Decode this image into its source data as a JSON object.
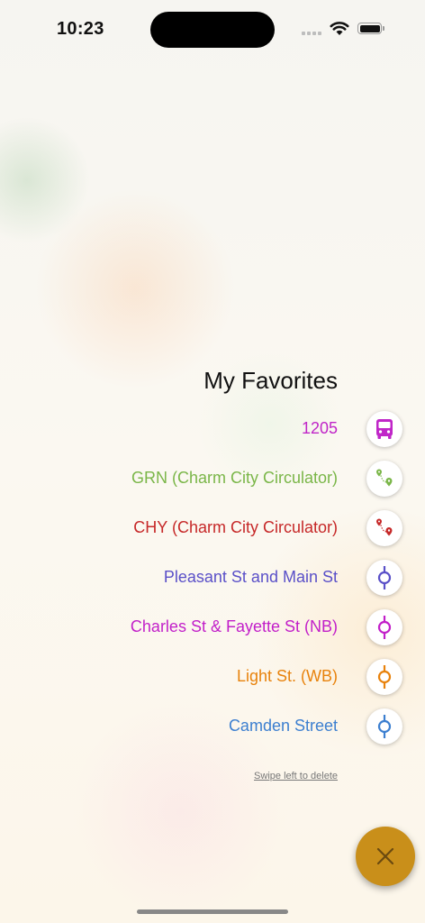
{
  "status_bar": {
    "time": "10:23"
  },
  "favorites": {
    "title": "My Favorites",
    "items": [
      {
        "label": "1205",
        "color": "#c026c8",
        "icon": "bus-icon"
      },
      {
        "label": "GRN (Charm City Circulator)",
        "color": "#7ab648",
        "icon": "route-icon"
      },
      {
        "label": "CHY (Charm City Circulator)",
        "color": "#c62828",
        "icon": "route-icon"
      },
      {
        "label": "Pleasant St and Main St",
        "color": "#5a50c8",
        "icon": "stop-icon"
      },
      {
        "label": "Charles St & Fayette St (NB)",
        "color": "#c21fc9",
        "icon": "stop-icon"
      },
      {
        "label": "Light St. (WB)",
        "color": "#e8820c",
        "icon": "stop-icon"
      },
      {
        "label": "Camden Street",
        "color": "#3c7fd0",
        "icon": "stop-icon"
      }
    ],
    "hint": "Swipe left to delete"
  },
  "fab": {
    "icon": "close-icon",
    "color": "#c98f1a"
  }
}
